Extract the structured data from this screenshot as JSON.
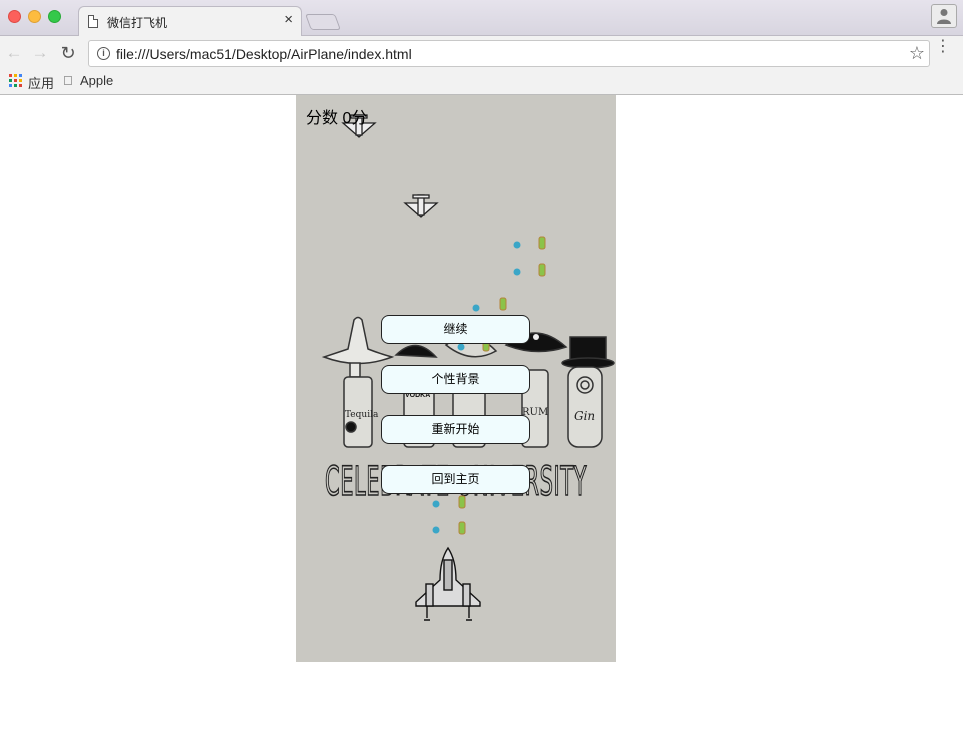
{
  "browser": {
    "tab_title": "微信打飞机",
    "tab_close": "×",
    "url": "file:///Users/mac51/Desktop/AirPlane/index.html",
    "bookmarks": [
      {
        "label": "应用",
        "icon": "apps-grid-icon"
      },
      {
        "label": "Apple",
        "icon": "apple-icon"
      }
    ]
  },
  "game": {
    "score_text": "分数 0分",
    "menu": [
      {
        "label": "继续"
      },
      {
        "label": "个性背景"
      },
      {
        "label": "重新开始"
      },
      {
        "label": "回到主页"
      }
    ],
    "background_text": "CELEBRATE UNIVERSITY",
    "bottle_labels": [
      "Tequila",
      "VODKA",
      "RUM",
      "Gin"
    ]
  }
}
